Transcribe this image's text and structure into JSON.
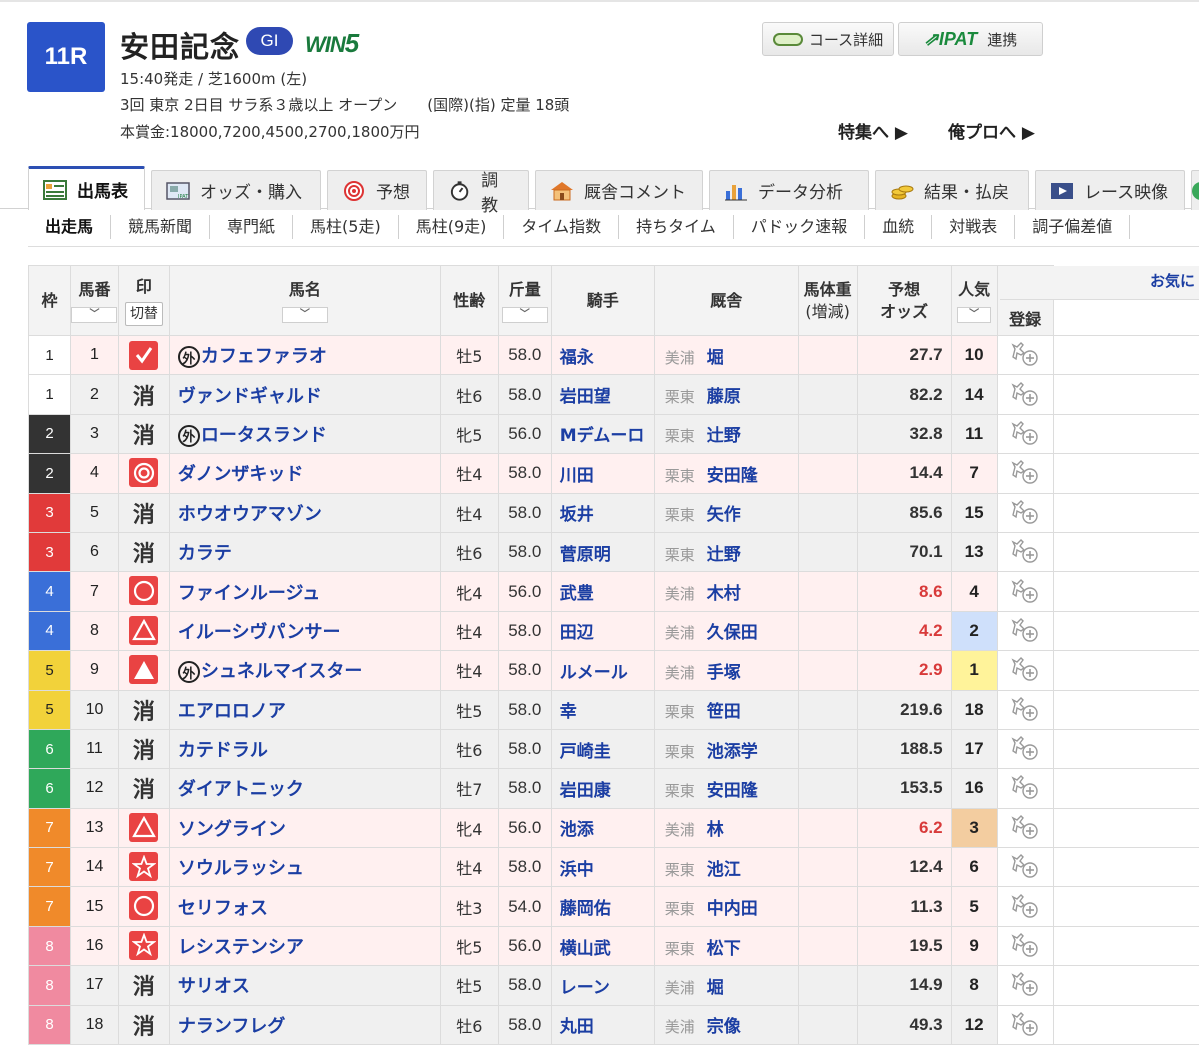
{
  "race": {
    "number": "11R",
    "name": "安田記念",
    "grade": "GI",
    "win5_prefix": "WIN",
    "win5_suffix": "5",
    "line1": "15:40発走 / 芝1600m (左)",
    "line2": "3回 東京 2日目 サラ系３歳以上 オープン　　(国際)(指) 定量 18頭",
    "line3": "本賞金:18000,7200,4500,2700,1800万円"
  },
  "header_buttons": {
    "course": "コース詳細",
    "ipat_logo": "IPAT",
    "ipat": "連携"
  },
  "links": {
    "feature": "特集へ ▶",
    "orepro": "俺プロへ ▶"
  },
  "tabs": [
    "出馬表",
    "オッズ・購入",
    "予想",
    "調教",
    "厩舎コメント",
    "データ分析",
    "結果・払戻",
    "レース映像"
  ],
  "subnav": [
    "出走馬",
    "競馬新聞",
    "専門紙",
    "馬柱(5走)",
    "馬柱(9走)",
    "タイム指数",
    "持ちタイム",
    "パドック速報",
    "血統",
    "対戦表",
    "調子偏差値"
  ],
  "columns": {
    "waku": "枠",
    "umaban": "馬番",
    "mark": "印",
    "toggle": "切替",
    "horse": "馬名",
    "sexage": "性齢",
    "weight": "斤量",
    "jockey": "騎手",
    "stable": "厩舎",
    "body1": "馬体重",
    "body2": "(増減)",
    "odds1": "予想",
    "odds2": "オッズ",
    "pop": "人気",
    "register": "登録",
    "favorite": "お気に"
  },
  "sort_symbol": "﹀",
  "foreign_mark": "外",
  "waku_colors": {
    "1": {
      "bg": "#ffffff",
      "fg": "#222222"
    },
    "2": {
      "bg": "#333333",
      "fg": "#ffffff"
    },
    "3": {
      "bg": "#e13a3a",
      "fg": "#ffffff"
    },
    "4": {
      "bg": "#3a6fd8",
      "fg": "#ffffff"
    },
    "5": {
      "bg": "#f2d23a",
      "fg": "#222222"
    },
    "6": {
      "bg": "#2fa85a",
      "fg": "#ffffff"
    },
    "7": {
      "bg": "#f08a2a",
      "fg": "#ffffff"
    },
    "8": {
      "bg": "#f08aa0",
      "fg": "#ffffff"
    }
  },
  "horses": [
    {
      "waku": "1",
      "umaban": "1",
      "mark": "check",
      "foreign": true,
      "name": "カフェファラオ",
      "sexage": "牡5",
      "weight": "58.0",
      "jockey": "福永",
      "region": "美浦",
      "trainer": "堀",
      "odds": "27.7",
      "pop": "10",
      "odds_red": false
    },
    {
      "waku": "1",
      "umaban": "2",
      "mark": "kesu",
      "foreign": false,
      "name": "ヴァンドギャルド",
      "sexage": "牡6",
      "weight": "58.0",
      "jockey": "岩田望",
      "region": "栗東",
      "trainer": "藤原",
      "odds": "82.2",
      "pop": "14",
      "odds_red": false
    },
    {
      "waku": "2",
      "umaban": "3",
      "mark": "kesu",
      "foreign": true,
      "name": "ロータスランド",
      "sexage": "牝5",
      "weight": "56.0",
      "jockey": "Mデムーロ",
      "region": "栗東",
      "trainer": "辻野",
      "odds": "32.8",
      "pop": "11",
      "odds_red": false
    },
    {
      "waku": "2",
      "umaban": "4",
      "mark": "double",
      "foreign": false,
      "name": "ダノンザキッド",
      "sexage": "牡4",
      "weight": "58.0",
      "jockey": "川田",
      "region": "栗東",
      "trainer": "安田隆",
      "odds": "14.4",
      "pop": "7",
      "odds_red": false
    },
    {
      "waku": "3",
      "umaban": "5",
      "mark": "kesu",
      "foreign": false,
      "name": "ホウオウアマゾン",
      "sexage": "牡4",
      "weight": "58.0",
      "jockey": "坂井",
      "region": "栗東",
      "trainer": "矢作",
      "odds": "85.6",
      "pop": "15",
      "odds_red": false
    },
    {
      "waku": "3",
      "umaban": "6",
      "mark": "kesu",
      "foreign": false,
      "name": "カラテ",
      "sexage": "牡6",
      "weight": "58.0",
      "jockey": "菅原明",
      "region": "栗東",
      "trainer": "辻野",
      "odds": "70.1",
      "pop": "13",
      "odds_red": false
    },
    {
      "waku": "4",
      "umaban": "7",
      "mark": "circle",
      "foreign": false,
      "name": "ファインルージュ",
      "sexage": "牝4",
      "weight": "56.0",
      "jockey": "武豊",
      "region": "美浦",
      "trainer": "木村",
      "odds": "8.6",
      "pop": "4",
      "odds_red": true
    },
    {
      "waku": "4",
      "umaban": "8",
      "mark": "triangle",
      "foreign": false,
      "name": "イルーシヴパンサー",
      "sexage": "牡4",
      "weight": "58.0",
      "jockey": "田辺",
      "region": "美浦",
      "trainer": "久保田",
      "odds": "4.2",
      "pop": "2",
      "odds_red": true
    },
    {
      "waku": "5",
      "umaban": "9",
      "mark": "filltri",
      "foreign": true,
      "name": "シュネルマイスター",
      "sexage": "牡4",
      "weight": "58.0",
      "jockey": "ルメール",
      "region": "美浦",
      "trainer": "手塚",
      "odds": "2.9",
      "pop": "1",
      "odds_red": true
    },
    {
      "waku": "5",
      "umaban": "10",
      "mark": "kesu",
      "foreign": false,
      "name": "エアロロノア",
      "sexage": "牡5",
      "weight": "58.0",
      "jockey": "幸",
      "region": "栗東",
      "trainer": "笹田",
      "odds": "219.6",
      "pop": "18",
      "odds_red": false
    },
    {
      "waku": "6",
      "umaban": "11",
      "mark": "kesu",
      "foreign": false,
      "name": "カテドラル",
      "sexage": "牡6",
      "weight": "58.0",
      "jockey": "戸崎圭",
      "region": "栗東",
      "trainer": "池添学",
      "odds": "188.5",
      "pop": "17",
      "odds_red": false
    },
    {
      "waku": "6",
      "umaban": "12",
      "mark": "kesu",
      "foreign": false,
      "name": "ダイアトニック",
      "sexage": "牡7",
      "weight": "58.0",
      "jockey": "岩田康",
      "region": "栗東",
      "trainer": "安田隆",
      "odds": "153.5",
      "pop": "16",
      "odds_red": false
    },
    {
      "waku": "7",
      "umaban": "13",
      "mark": "triangle",
      "foreign": false,
      "name": "ソングライン",
      "sexage": "牝4",
      "weight": "56.0",
      "jockey": "池添",
      "region": "美浦",
      "trainer": "林",
      "odds": "6.2",
      "pop": "3",
      "odds_red": true
    },
    {
      "waku": "7",
      "umaban": "14",
      "mark": "star",
      "foreign": false,
      "name": "ソウルラッシュ",
      "sexage": "牡4",
      "weight": "58.0",
      "jockey": "浜中",
      "region": "栗東",
      "trainer": "池江",
      "odds": "12.4",
      "pop": "6",
      "odds_red": false
    },
    {
      "waku": "7",
      "umaban": "15",
      "mark": "circle",
      "foreign": false,
      "name": "セリフォス",
      "sexage": "牡3",
      "weight": "54.0",
      "jockey": "藤岡佑",
      "region": "栗東",
      "trainer": "中内田",
      "odds": "11.3",
      "pop": "5",
      "odds_red": false
    },
    {
      "waku": "8",
      "umaban": "16",
      "mark": "star",
      "foreign": false,
      "name": "レシステンシア",
      "sexage": "牝5",
      "weight": "56.0",
      "jockey": "横山武",
      "region": "栗東",
      "trainer": "松下",
      "odds": "19.5",
      "pop": "9",
      "odds_red": false
    },
    {
      "waku": "8",
      "umaban": "17",
      "mark": "kesu",
      "foreign": false,
      "name": "サリオス",
      "sexage": "牡5",
      "weight": "58.0",
      "jockey": "レーン",
      "region": "美浦",
      "trainer": "堀",
      "odds": "14.9",
      "pop": "8",
      "odds_red": false
    },
    {
      "waku": "8",
      "umaban": "18",
      "mark": "kesu",
      "foreign": false,
      "name": "ナランフレグ",
      "sexage": "牡6",
      "weight": "58.0",
      "jockey": "丸田",
      "region": "美浦",
      "trainer": "宗像",
      "odds": "49.3",
      "pop": "12",
      "odds_red": false
    }
  ],
  "kesu_label": "消"
}
